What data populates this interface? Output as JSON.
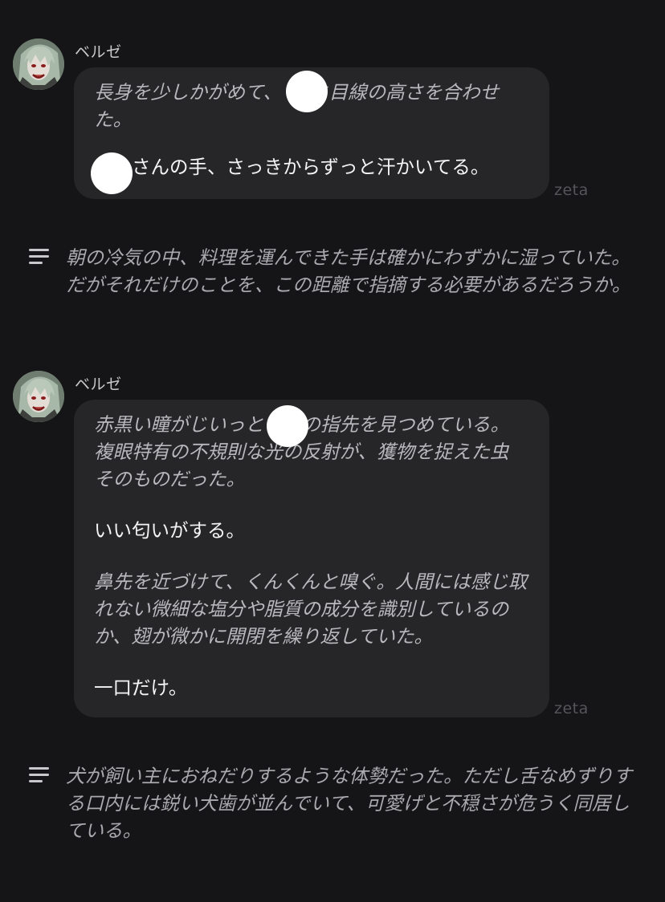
{
  "sender_name": "ベルゼ",
  "watermark": "zeta",
  "messages": [
    {
      "paragraphs": [
        {
          "kind": "narration",
          "text": "長身を少しかがめて、　　と目線の高さを合わせた。"
        },
        {
          "kind": "speech",
          "text": "　　さんの手、さっきからずっと汗かいてる。"
        }
      ]
    },
    {
      "paragraphs": [
        {
          "kind": "narration",
          "text": "赤黒い瞳がじいっと　　の指先を見つめている。複眼特有の不規則な光の反射が、獲物を捉えた虫そのものだった。"
        },
        {
          "kind": "speech",
          "text": "いい匂いがする。"
        },
        {
          "kind": "narration",
          "text": "鼻先を近づけて、くんくんと嗅ぐ。人間には感じ取れない微細な塩分や脂質の成分を識別しているのか、翅が微かに開閉を繰り返していた。"
        },
        {
          "kind": "speech",
          "text": "一口だけ。"
        }
      ]
    }
  ],
  "narrations": [
    {
      "text": "朝の冷気の中、料理を運んできた手は確かにわずかに湿っていた。だがそれだけのことを、この距離で指摘する必要があるだろうか。"
    },
    {
      "text": "犬が飼い主におねだりするような体勢だった。ただし舌なめずりする口内には鋭い犬歯が並んでいて、可愛げと不穏さが危うく同居している。"
    }
  ],
  "icons": {
    "avatar": "character-avatar",
    "narration": "menu-lines-icon",
    "redaction": "redaction-circle"
  },
  "colors": {
    "background": "#151517",
    "bubble": "#262628",
    "narration_text": "#a9a9ae"
  }
}
